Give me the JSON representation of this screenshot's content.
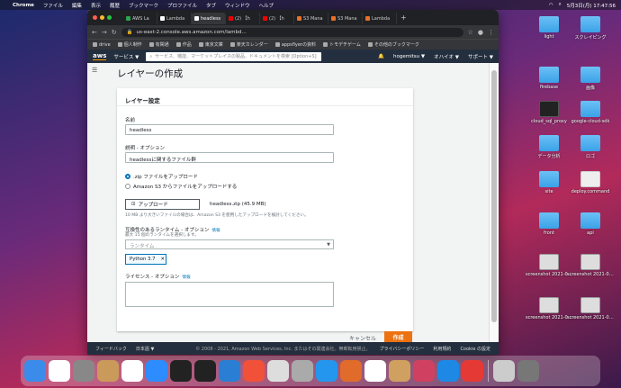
{
  "menubar": {
    "app": "Chrome",
    "items": [
      "ファイル",
      "編集",
      "表示",
      "履歴",
      "ブックマーク",
      "プロファイル",
      "タブ",
      "ウィンドウ",
      "ヘルプ"
    ],
    "clock": "5月3日(月)  17:47:56"
  },
  "browser": {
    "tabs": [
      {
        "label": "AWS La",
        "color": "#2ea44f"
      },
      {
        "label": "Lambda",
        "color": "#fff"
      },
      {
        "label": "headless",
        "color": "#fff"
      },
      {
        "label": "(2) 【h",
        "color": "#e00"
      },
      {
        "label": "(2) 【h",
        "color": "#e00"
      },
      {
        "label": "S3 Mana",
        "color": "#e8702a"
      },
      {
        "label": "S3 Mana",
        "color": "#e8702a"
      },
      {
        "label": "Lambda",
        "color": "#e8702a"
      }
    ],
    "url": "us-east-2.console.aws.amazon.com/lambd...",
    "bookmarks": [
      "drive",
      "個人制作",
      "有閑通",
      "作品",
      "東京文庫",
      "楽天カレンダー",
      "appsflyerの資料",
      "トモデチゲーム",
      "その他のブックマーク"
    ]
  },
  "aws": {
    "logo": "aws",
    "services": "サービス ▼",
    "search_placeholder": "サービス、機能、マーケットプレイスの製品、ドキュメントを検索 [Option+S]",
    "user": "hogemitsu ▼",
    "region": "オハイオ ▼",
    "support": "サポート ▼"
  },
  "page": {
    "title": "レイヤーの作成",
    "panel_title": "レイヤー設定",
    "name_label": "名前",
    "name_value": "headless",
    "desc_label": "説明 - オプション",
    "desc_value": "headlessに関するファイル群",
    "radio_zip": ".zip ファイルをアップロード",
    "radio_s3": "Amazon S3 からファイルをアップロードする",
    "upload_button": "アップロード",
    "upload_file": "headless.zip (45.9 MB)",
    "upload_hint": "10 MB より大きいファイルの場合は、Amazon S3 を使用したアップロードを検討してください。",
    "runtime_label": "互換性のあるランタイム - オプション",
    "runtime_info": "情報",
    "runtime_sub": "最大 15 個のランタイムを選択します。",
    "runtime_placeholder": "ランタイム",
    "runtime_token": "Python 3.7",
    "license_label": "ライセンス - オプション",
    "license_info": "情報",
    "cancel": "キャンセル",
    "create": "作成"
  },
  "footer": {
    "feedback": "フィードバック",
    "lang": "日本語 ▼",
    "copyright": "© 2008 - 2021, Amazon Web Services, Inc. またはその関連会社。無断転用禁止。",
    "privacy": "プライバシーポリシー",
    "terms": "利用規約",
    "cookie": "Cookie の設定"
  },
  "desktop": [
    {
      "label": "light",
      "kind": "folder"
    },
    {
      "label": "スクレイピング",
      "kind": "folder"
    },
    {
      "label": "firebase",
      "kind": "folder"
    },
    {
      "label": "画像",
      "kind": "folder"
    },
    {
      "label": "cloud_sql_proxy",
      "kind": "term"
    },
    {
      "label": "google-cloud-sdk",
      "kind": "folder"
    },
    {
      "label": "データ分析",
      "kind": "folder"
    },
    {
      "label": "ロゴ",
      "kind": "folder"
    },
    {
      "label": "site",
      "kind": "folder"
    },
    {
      "label": "deploy.command",
      "kind": "file"
    },
    {
      "label": "front",
      "kind": "folder"
    },
    {
      "label": "api",
      "kind": "folder"
    },
    {
      "label": "screenshot 2021-05...1.00.png",
      "kind": "shot"
    },
    {
      "label": "screenshot 2021-05...9.21.png",
      "kind": "shot"
    },
    {
      "label": "screenshot 2021-05...06.png",
      "kind": "shot"
    },
    {
      "label": "screenshot 2021-05...29.png",
      "kind": "shot"
    }
  ],
  "dock": [
    "finder",
    "calendar",
    "settings",
    "app",
    "chrome",
    "zoom",
    "terminal",
    "terminal",
    "vscode",
    "swift",
    "music",
    "app",
    "docker",
    "app",
    "app",
    "app",
    "app",
    "infinity",
    "app",
    "preview",
    "trash"
  ]
}
